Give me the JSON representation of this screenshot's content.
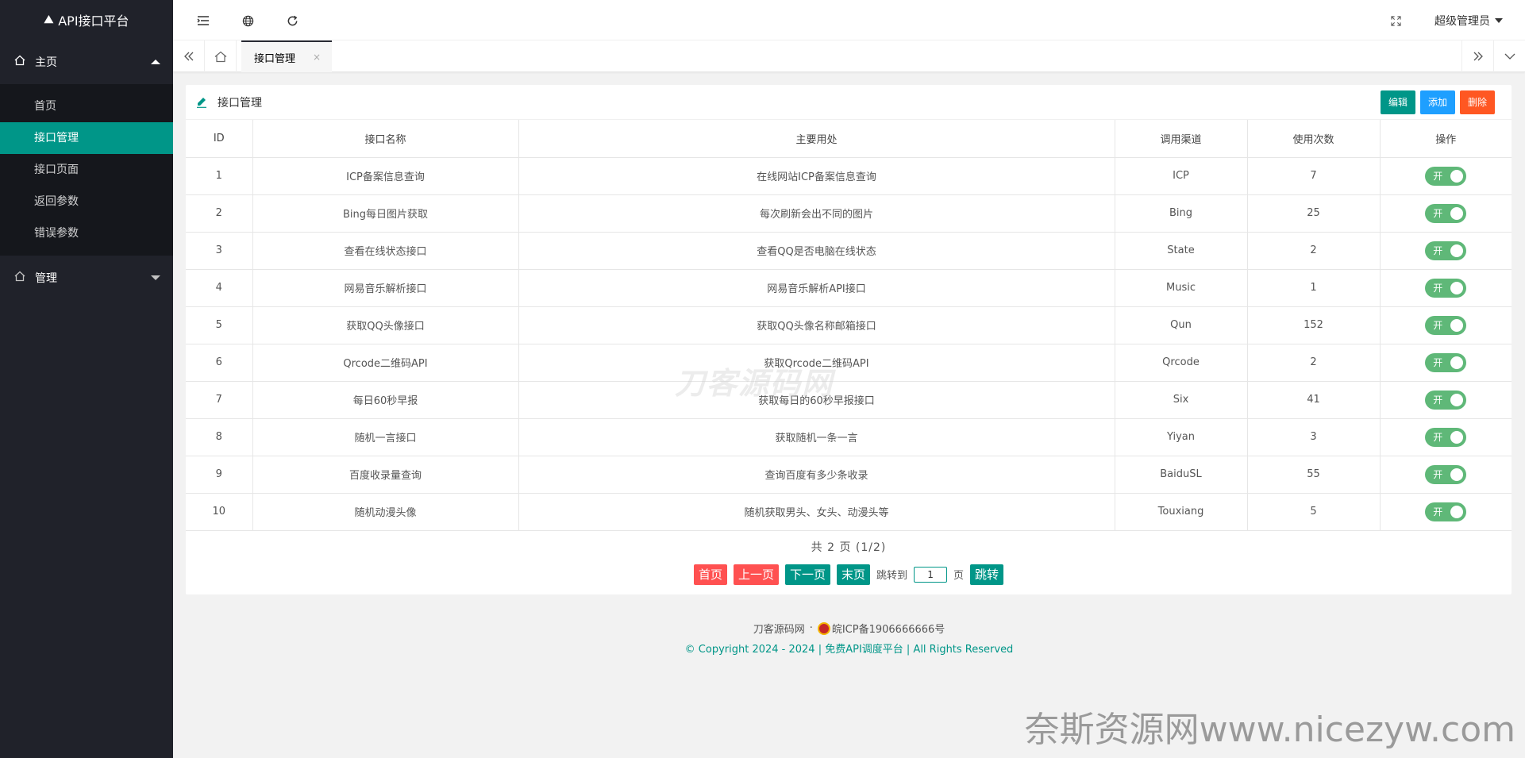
{
  "app": {
    "title": "API接口平台"
  },
  "sidebar": {
    "groups": [
      {
        "label": "主页",
        "expanded": true
      },
      {
        "label": "管理",
        "expanded": false
      }
    ],
    "items": [
      {
        "label": "首页"
      },
      {
        "label": "接口管理",
        "active": true
      },
      {
        "label": "接口页面"
      },
      {
        "label": "返回参数"
      },
      {
        "label": "错误参数"
      }
    ]
  },
  "header": {
    "user": "超级管理员"
  },
  "tabs": {
    "active_label": "接口管理",
    "close_glyph": "×"
  },
  "card": {
    "title": "接口管理",
    "buttons": {
      "edit": "编辑",
      "add": "添加",
      "delete": "删除"
    }
  },
  "table": {
    "columns": [
      "ID",
      "接口名称",
      "主要用处",
      "调用渠道",
      "使用次数",
      "操作"
    ],
    "switch_label": "开",
    "rows": [
      {
        "id": "1",
        "name": "ICP备案信息查询",
        "use": "在线网站ICP备案信息查询",
        "channel": "ICP",
        "count": "7"
      },
      {
        "id": "2",
        "name": "Bing每日图片获取",
        "use": "每次刷新会出不同的图片",
        "channel": "Bing",
        "count": "25"
      },
      {
        "id": "3",
        "name": "查看在线状态接口",
        "use": "查看QQ是否电脑在线状态",
        "channel": "State",
        "count": "2"
      },
      {
        "id": "4",
        "name": "网易音乐解析接口",
        "use": "网易音乐解析API接口",
        "channel": "Music",
        "count": "1"
      },
      {
        "id": "5",
        "name": "获取QQ头像接口",
        "use": "获取QQ头像名称邮箱接口",
        "channel": "Qun",
        "count": "152"
      },
      {
        "id": "6",
        "name": "Qrcode二维码API",
        "use": "获取Qrcode二维码API",
        "channel": "Qrcode",
        "count": "2"
      },
      {
        "id": "7",
        "name": "每日60秒早报",
        "use": "获取每日的60秒早报接口",
        "channel": "Six",
        "count": "41"
      },
      {
        "id": "8",
        "name": "随机一言接口",
        "use": "获取随机一条一言",
        "channel": "Yiyan",
        "count": "3"
      },
      {
        "id": "9",
        "name": "百度收录量查询",
        "use": "查询百度有多少条收录",
        "channel": "BaiduSL",
        "count": "55"
      },
      {
        "id": "10",
        "name": "随机动漫头像",
        "use": "随机获取男头、女头、动漫头等",
        "channel": "Touxiang",
        "count": "5"
      }
    ]
  },
  "pagination": {
    "info": "共 2 页 (1/2)",
    "first": "首页",
    "prev": "上一页",
    "next": "下一页",
    "last": "末页",
    "jump_to": "跳转到",
    "page_value": "1",
    "page_unit": "页",
    "go": "跳转"
  },
  "watermark": "刀客源码网",
  "footer": {
    "site": "刀客源码网",
    "separator": "·",
    "icp": "皖ICP备1906666666号",
    "copyright": "© Copyright 2024 - 2024 | 免费API调度平台 | All Rights Reserved"
  },
  "corner_watermark": "奈斯资源网www.nicezyw.com"
}
